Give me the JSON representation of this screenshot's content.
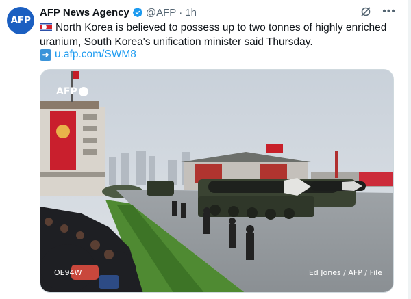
{
  "account": {
    "avatar_text": "AFP",
    "name": "AFP News Agency",
    "handle": "@AFP",
    "separator": "·",
    "time": "1h"
  },
  "tweet": {
    "text": "North Korea is believed to possess up to two tonnes of highly enriched uranium, South Korea's unification minister said Thursday.",
    "link": "u.afp.com/SWM8"
  },
  "media": {
    "watermark": "AFP",
    "code": "OE94W",
    "credit": "Ed Jones / AFP / File"
  },
  "colors": {
    "avatar": "#1b5fc1",
    "link": "#1d9bf0",
    "verified": "#1d9bf0",
    "muted": "#536471"
  },
  "icons": [
    "verified-badge-icon",
    "grok-icon",
    "more-icon",
    "south-korea-flag-icon",
    "right-arrow-icon"
  ]
}
